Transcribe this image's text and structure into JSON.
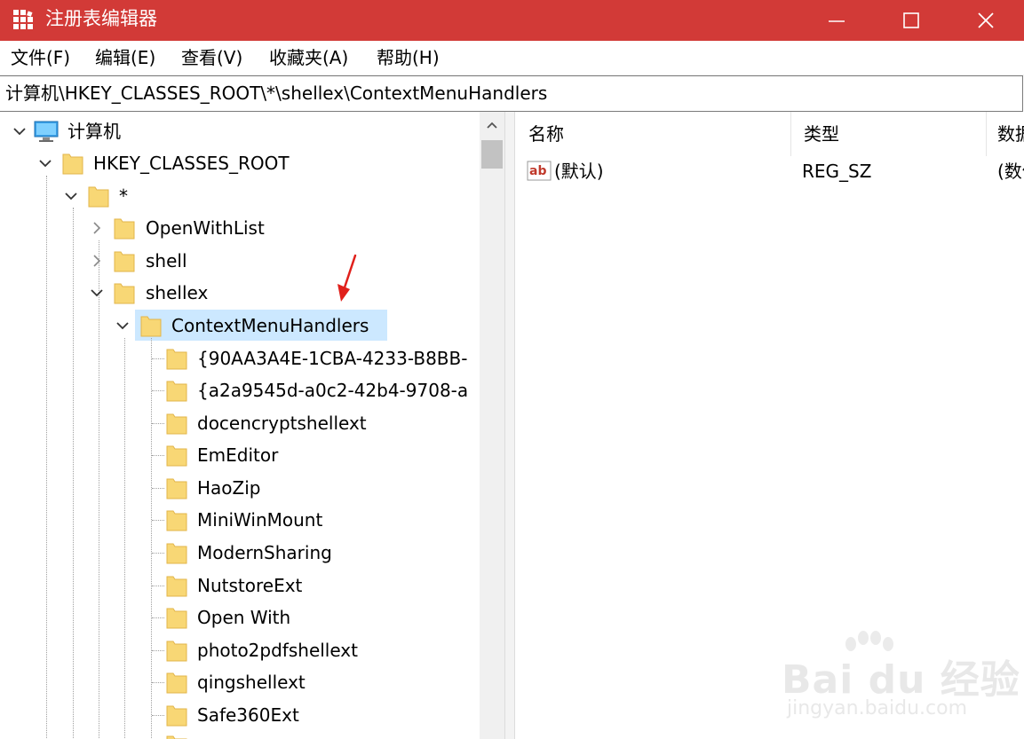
{
  "window": {
    "title": "注册表编辑器",
    "accent_color": "#d23a37",
    "icons": [
      "registry-editor-app-icon",
      "minimize-icon",
      "maximize-icon",
      "close-icon"
    ]
  },
  "menu": {
    "items": [
      "文件(F)",
      "编辑(E)",
      "查看(V)",
      "收藏夹(A)",
      "帮助(H)"
    ]
  },
  "address": {
    "path": "计算机\\HKEY_CLASSES_ROOT\\*\\shellex\\ContextMenuHandlers"
  },
  "tree": {
    "nodes": [
      {
        "label": "计算机",
        "icon": "computer-icon",
        "expander": "expanded"
      },
      {
        "label": "HKEY_CLASSES_ROOT",
        "icon": "folder-icon",
        "expander": "expanded"
      },
      {
        "label": "*",
        "icon": "folder-icon",
        "expander": "expanded"
      },
      {
        "label": "OpenWithList",
        "icon": "folder-icon",
        "expander": "collapsed"
      },
      {
        "label": "shell",
        "icon": "folder-icon",
        "expander": "collapsed"
      },
      {
        "label": "shellex",
        "icon": "folder-icon",
        "expander": "expanded"
      },
      {
        "label": "ContextMenuHandlers",
        "icon": "folder-icon",
        "expander": "expanded",
        "selected": true
      },
      {
        "label": "{90AA3A4E-1CBA-4233-B8BB-",
        "icon": "folder-icon"
      },
      {
        "label": "{a2a9545d-a0c2-42b4-9708-a",
        "icon": "folder-icon"
      },
      {
        "label": "docencryptshellext",
        "icon": "folder-icon"
      },
      {
        "label": "EmEditor",
        "icon": "folder-icon"
      },
      {
        "label": "HaoZip",
        "icon": "folder-icon"
      },
      {
        "label": "MiniWinMount",
        "icon": "folder-icon"
      },
      {
        "label": "ModernSharing",
        "icon": "folder-icon"
      },
      {
        "label": "NutstoreExt",
        "icon": "folder-icon"
      },
      {
        "label": "Open With",
        "icon": "folder-icon"
      },
      {
        "label": "photo2pdfshellext",
        "icon": "folder-icon"
      },
      {
        "label": "qingshellext",
        "icon": "folder-icon"
      },
      {
        "label": "Safe360Ext",
        "icon": "folder-icon"
      }
    ]
  },
  "values": {
    "columns": [
      "名称",
      "类型",
      "数据"
    ],
    "rows": [
      {
        "name": "(默认)",
        "type": "REG_SZ",
        "data": "(数值未设置)",
        "icon": "string-value-icon"
      }
    ]
  },
  "colors": {
    "selection": "#cce8ff",
    "folder": "#f8d775"
  },
  "watermark": {
    "brand": "Bai du 经验",
    "url": "jingyan.baidu.com"
  }
}
